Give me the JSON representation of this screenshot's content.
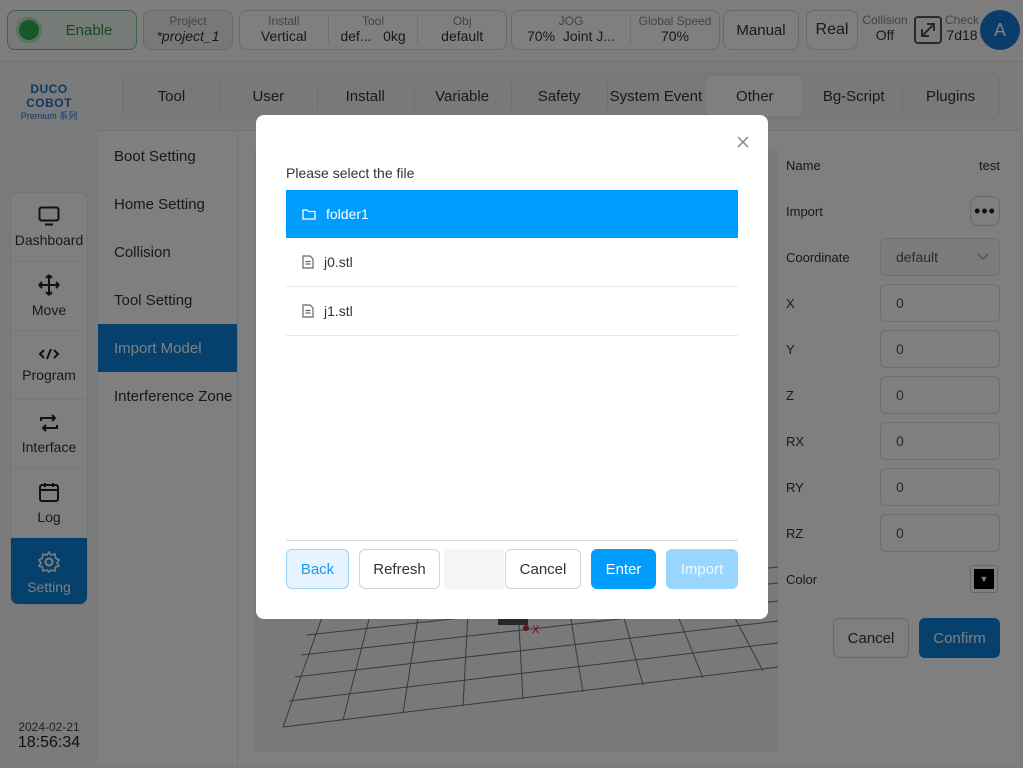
{
  "topbar": {
    "enable_label": "Enable",
    "project": {
      "caption": "Project",
      "value": "*project_1"
    },
    "install": {
      "caption": "Install",
      "value": "Vertical"
    },
    "tool": {
      "caption": "Tool",
      "value_name": "def...",
      "value_weight": "0kg"
    },
    "obj": {
      "caption": "Obj",
      "value": "default"
    },
    "jog": {
      "caption": "JOG",
      "value_percent": "70%",
      "value_mode": "Joint J..."
    },
    "global_speed": {
      "caption": "Global Speed",
      "value": "70%"
    },
    "manual_label": "Manual",
    "real_label": "Real",
    "collision": {
      "caption": "Collision",
      "value": "Off"
    },
    "check": {
      "caption": "Check",
      "value": "7d18"
    },
    "avatar_letter": "A"
  },
  "logo": {
    "brand": "DUCO COBOT",
    "series": "Premium 系列"
  },
  "sidebar": {
    "items": [
      {
        "label": "Dashboard",
        "icon": "monitor-icon"
      },
      {
        "label": "Move",
        "icon": "move-arrows-icon"
      },
      {
        "label": "Program",
        "icon": "code-icon"
      },
      {
        "label": "Interface",
        "icon": "swap-icon"
      },
      {
        "label": "Log",
        "icon": "calendar-icon"
      },
      {
        "label": "Setting",
        "icon": "gear-icon",
        "active": true
      }
    ]
  },
  "datetime": {
    "date": "2024-02-21",
    "time": "18:56:34"
  },
  "tabs": [
    "Tool",
    "User",
    "Install",
    "Variable",
    "Safety",
    "System Event",
    "Other",
    "Bg-Script",
    "Plugins"
  ],
  "active_tab": "Other",
  "settings_menu": [
    "Boot Setting",
    "Home Setting",
    "Collision",
    "Tool Setting",
    "Import Model",
    "Interference Zone"
  ],
  "active_setting": "Import Model",
  "props": {
    "name_label": "Name",
    "name_value": "test",
    "import_label": "Import",
    "import_button": "•••",
    "coordinate_label": "Coordinate",
    "coordinate_value": "default",
    "x_label": "X",
    "x_value": "0",
    "y_label": "Y",
    "y_value": "0",
    "z_label": "Z",
    "z_value": "0",
    "rx_label": "RX",
    "rx_value": "0",
    "ry_label": "RY",
    "ry_value": "0",
    "rz_label": "RZ",
    "rz_value": "0",
    "color_label": "Color",
    "color_value": "#000000",
    "cancel_label": "Cancel",
    "confirm_label": "Confirm"
  },
  "viewport": {
    "axis_label": "X"
  },
  "modal": {
    "title": "Please select the file",
    "files": [
      {
        "name": "folder1",
        "type": "folder",
        "selected": true
      },
      {
        "name": "j0.stl",
        "type": "file"
      },
      {
        "name": "j1.stl",
        "type": "file"
      }
    ],
    "back_label": "Back",
    "refresh_label": "Refresh",
    "cancel_label": "Cancel",
    "enter_label": "Enter",
    "import_label": "Import"
  },
  "colors": {
    "primary": "#0a82d8",
    "selected_row": "#009dff",
    "enable_green": "#2fae54"
  }
}
